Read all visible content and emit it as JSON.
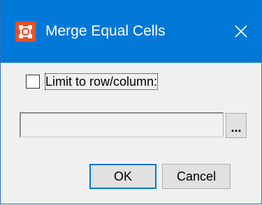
{
  "window": {
    "title": "Merge Equal Cells",
    "colors": {
      "titlebar": "#0078d7",
      "app_icon": "#e94f24",
      "body": "#f0f0f0"
    },
    "icons": {
      "app": "app-icon",
      "close": "close-icon"
    }
  },
  "options": {
    "limit_label": "Limit to row/column:",
    "limit_checked": false
  },
  "path_field": {
    "value": "",
    "browse_label": "..."
  },
  "buttons": {
    "ok_label": "OK",
    "cancel_label": "Cancel"
  }
}
